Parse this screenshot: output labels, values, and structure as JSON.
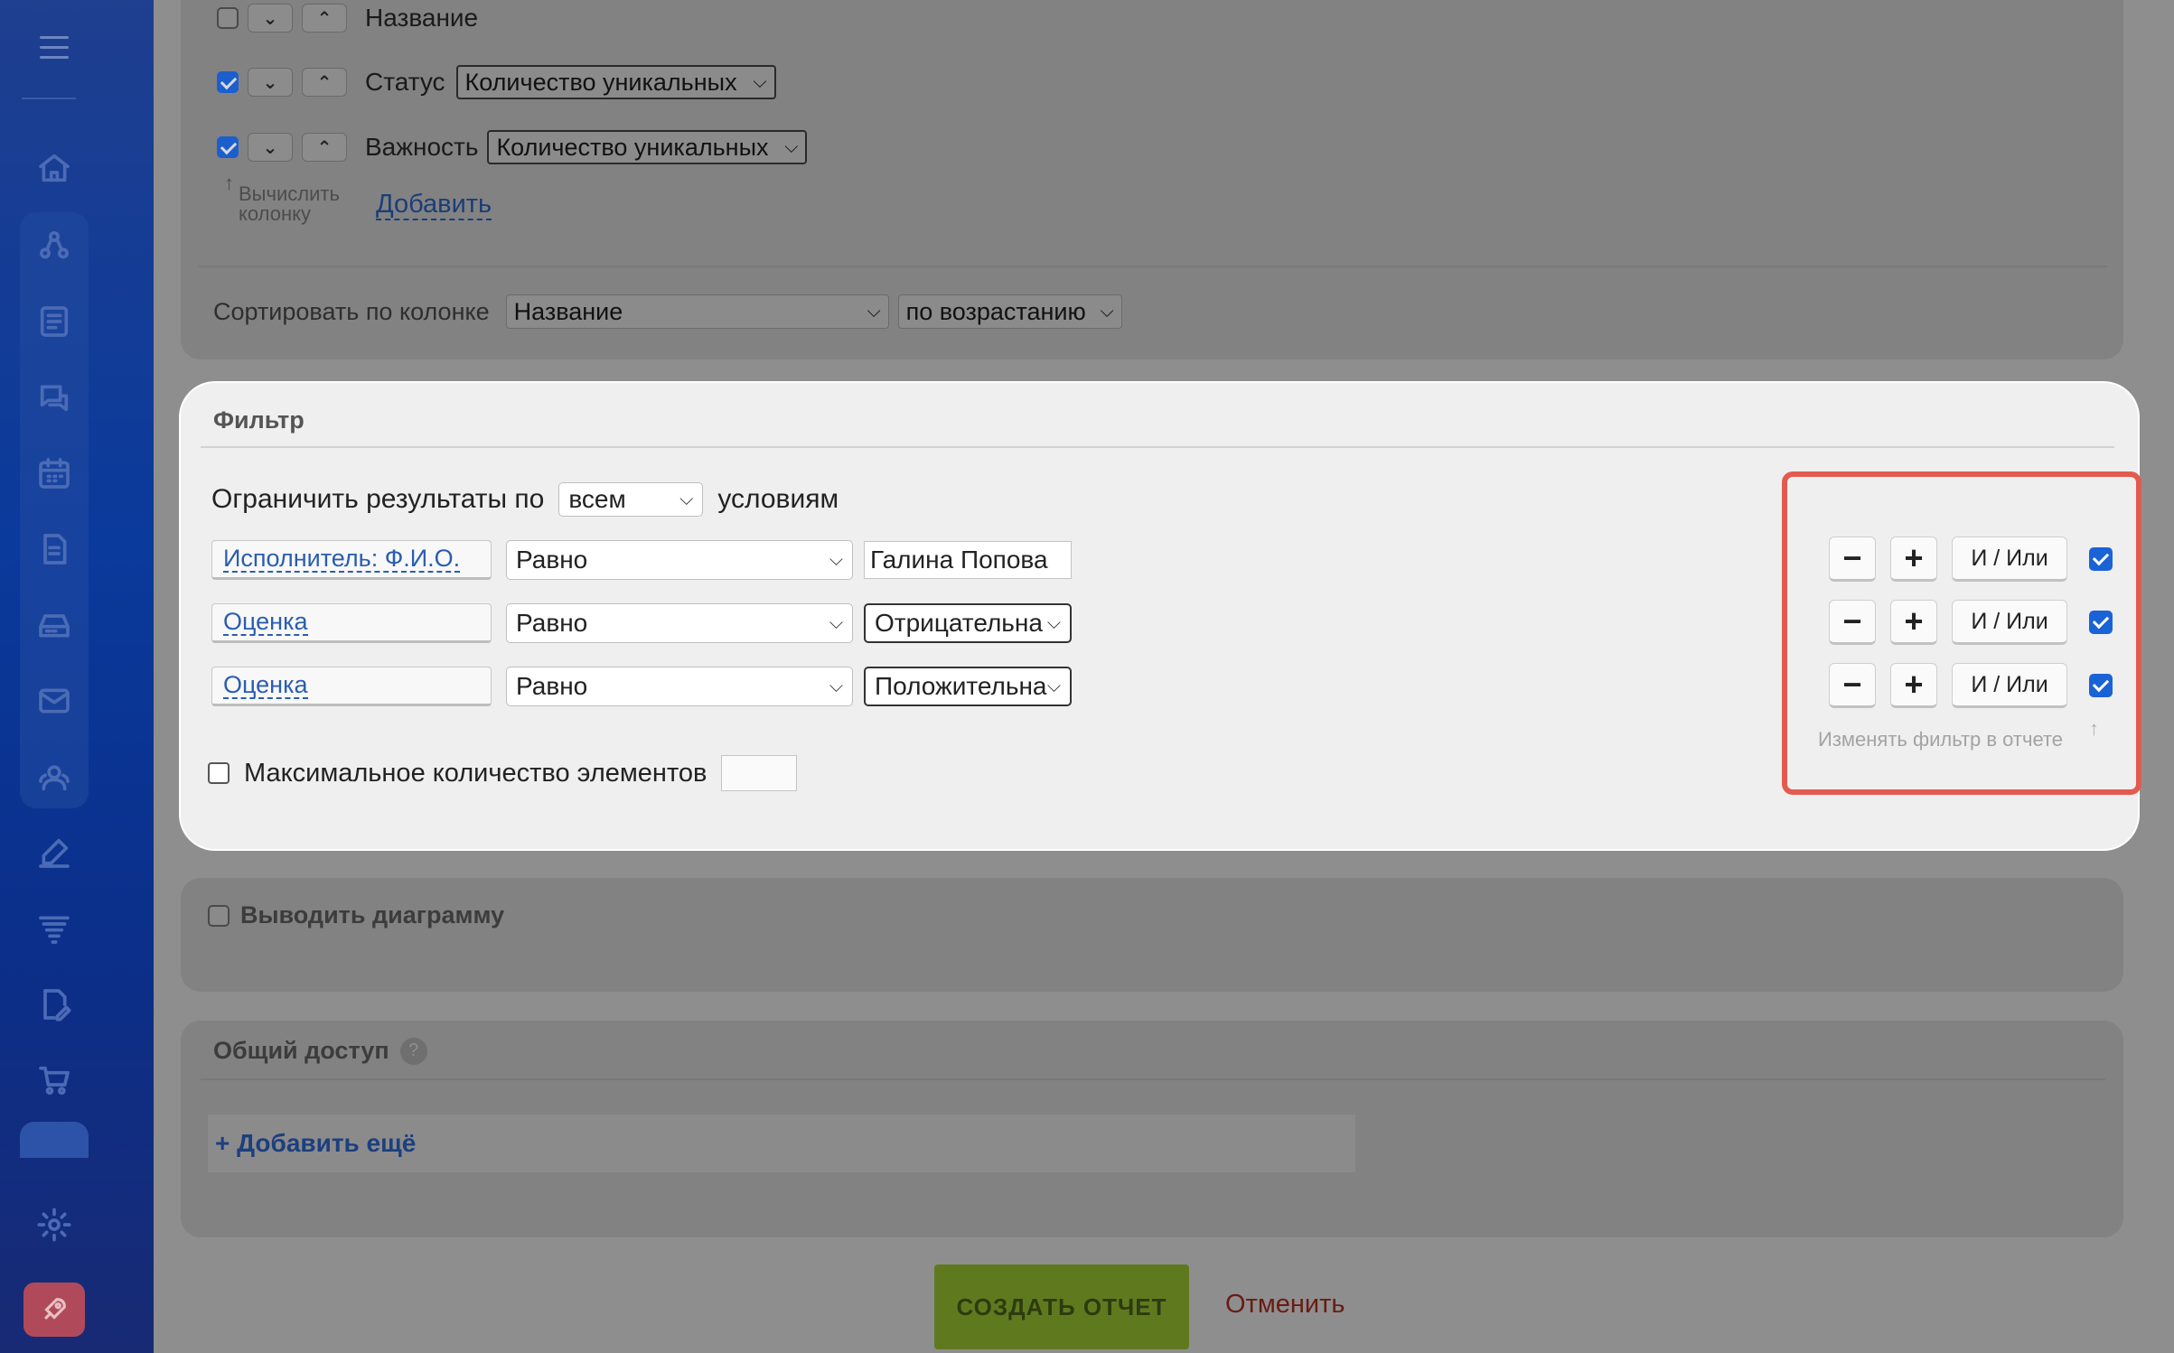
{
  "columns": {
    "rows": [
      {
        "label": "Название",
        "checked": false,
        "aggregate": ""
      },
      {
        "label": "Статус",
        "checked": true,
        "aggregate": "Количество уникальных"
      },
      {
        "label": "Важность",
        "checked": true,
        "aggregate": "Количество уникальных"
      }
    ],
    "compute_hint": "Вычислить колонку",
    "add_link": "Добавить",
    "sort_label": "Сортировать по колонке",
    "sort_column": "Название",
    "sort_order": "по возрастанию"
  },
  "filter": {
    "title": "Фильтр",
    "limit_prefix": "Ограничить результаты по",
    "limit_mode": "всем",
    "limit_suffix": "условиям",
    "rows": [
      {
        "field": "Исполнитель: Ф.И.О.",
        "operator": "Равно",
        "value": "Галина Попова",
        "value_type": "text"
      },
      {
        "field": "Оценка",
        "operator": "Равно",
        "value": "Отрицательна",
        "value_type": "select"
      },
      {
        "field": "Оценка",
        "operator": "Равно",
        "value": "Положительна",
        "value_type": "select"
      }
    ],
    "max_items_label": "Максимальное количество элементов",
    "minus_label": "−",
    "plus_label": "+",
    "andor_label": "И / Или",
    "change_hint": "Изменять фильтр в отчете"
  },
  "diagram": {
    "label": "Выводить диаграмму"
  },
  "access": {
    "title": "Общий доступ",
    "help": "?",
    "add_more": "+ Добавить ещё"
  },
  "actions": {
    "create": "СОЗДАТЬ ОТЧЕТ",
    "cancel": "Отменить"
  },
  "colors": {
    "highlight": "#e35a4f",
    "accent_blue": "#1a63d6",
    "create_green": "#5f7a1e"
  },
  "sidebar_icons": [
    "menu-icon",
    "home-icon",
    "crm-icon",
    "news-icon",
    "chat-icon",
    "calendar-icon",
    "document-icon",
    "inbox-icon",
    "mail-icon",
    "users-icon",
    "sign-icon",
    "filter-stack-icon",
    "edit-doc-icon",
    "cart-icon",
    "tasks-icon",
    "settings-icon",
    "rocket-icon"
  ]
}
